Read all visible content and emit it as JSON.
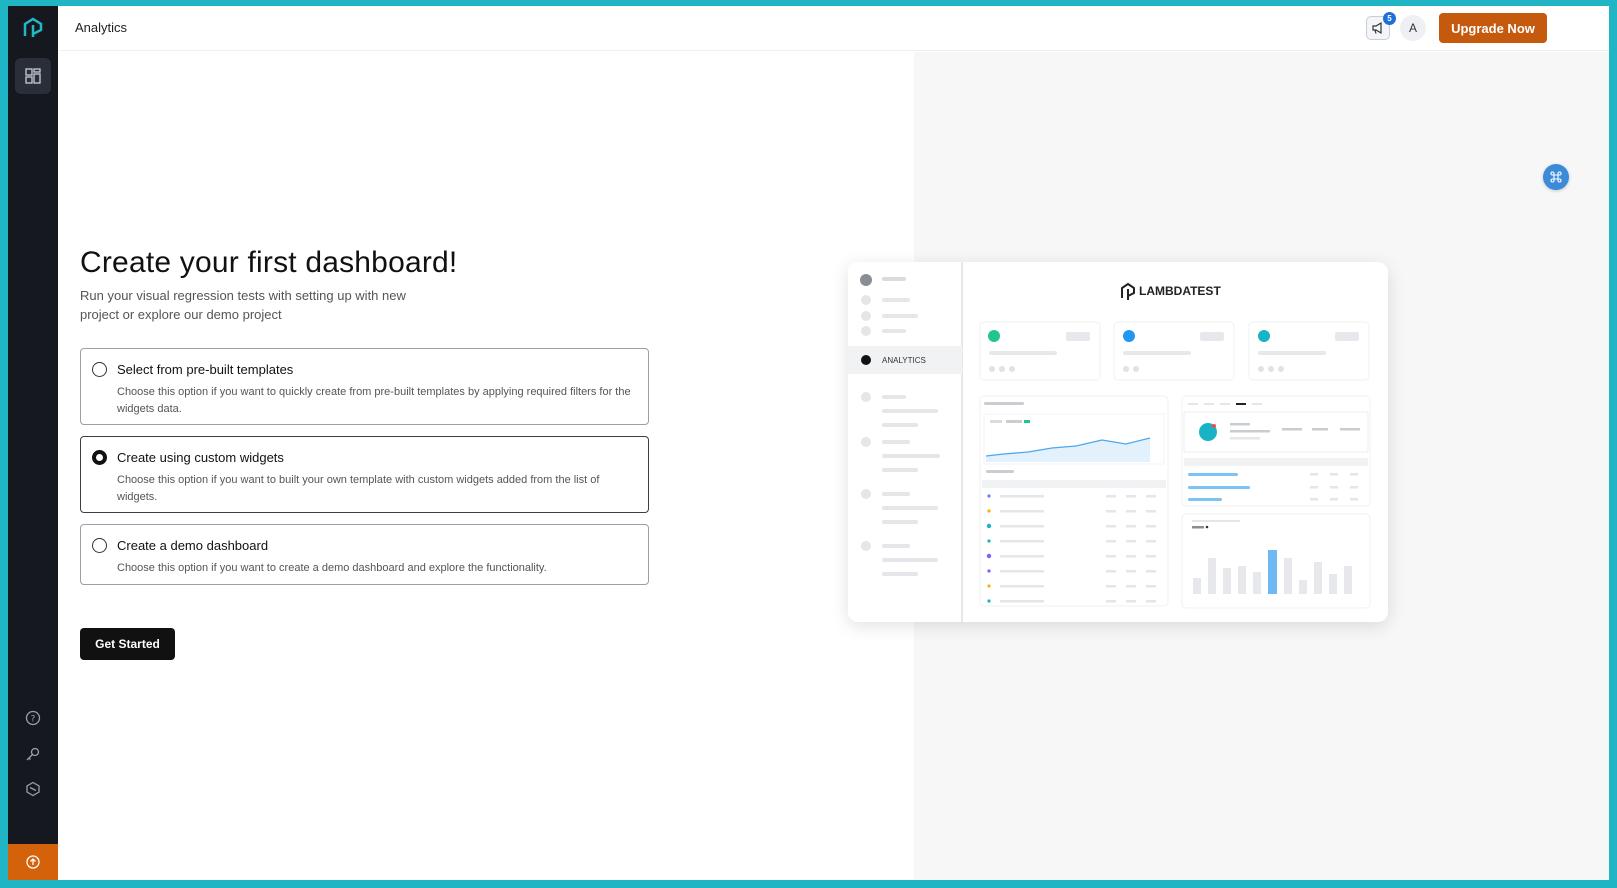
{
  "topbar": {
    "title": "Analytics",
    "announcement_count": "5",
    "avatar_initial": "A",
    "upgrade_label": "Upgrade Now"
  },
  "sidebar": {
    "active_item": "dashboard-icon",
    "bottom_icons": [
      "help-icon",
      "key-icon",
      "integrations-icon",
      "upgrade-icon"
    ]
  },
  "main": {
    "heading": "Create your first dashboard!",
    "subheading": "Run your visual regression tests with setting up with new project or explore our demo project",
    "options": [
      {
        "title": "Select from pre-built templates",
        "description": "Choose this option if you want to quickly create from pre-built templates by applying required filters for the widgets data.",
        "selected": false
      },
      {
        "title": "Create using custom widgets",
        "description": "Choose this option if you want to built your own template with custom widgets added from the list of widgets.",
        "selected": true
      },
      {
        "title": "Create a demo dashboard",
        "description": "Choose this option if you want to create a demo dashboard and explore the functionality.",
        "selected": false
      }
    ],
    "cta_label": "Get Started"
  },
  "preview": {
    "brand": "LAMBDATEST",
    "nav_active_label": "ANALYTICS"
  },
  "colors": {
    "sidebar_bg": "#16181f",
    "accent_orange": "#c55a0f",
    "frame_teal": "#1fb5c4",
    "primary_blue": "#1e6fd9"
  }
}
